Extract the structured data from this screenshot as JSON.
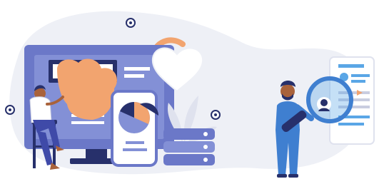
{
  "illustration": {
    "colors": {
      "backdrop": "#eef0f6",
      "monitor": "#6b78c8",
      "monitor_screen": "#8390d6",
      "accent_orange": "#f2a46f",
      "dark_navy": "#27306b",
      "person_blue": "#3f7fd0",
      "light_blue": "#5aa6e6",
      "skin": "#a9623b",
      "white": "#ffffff"
    },
    "icons": [
      "person-sitting-icon",
      "monitor-icon",
      "smartphone-icon",
      "pie-chart-icon",
      "heart-icon",
      "server-stack-icon",
      "magnifying-glass-icon",
      "profile-card-icon",
      "person-standing-icon",
      "plant-icon",
      "dot-marker-icon"
    ]
  }
}
